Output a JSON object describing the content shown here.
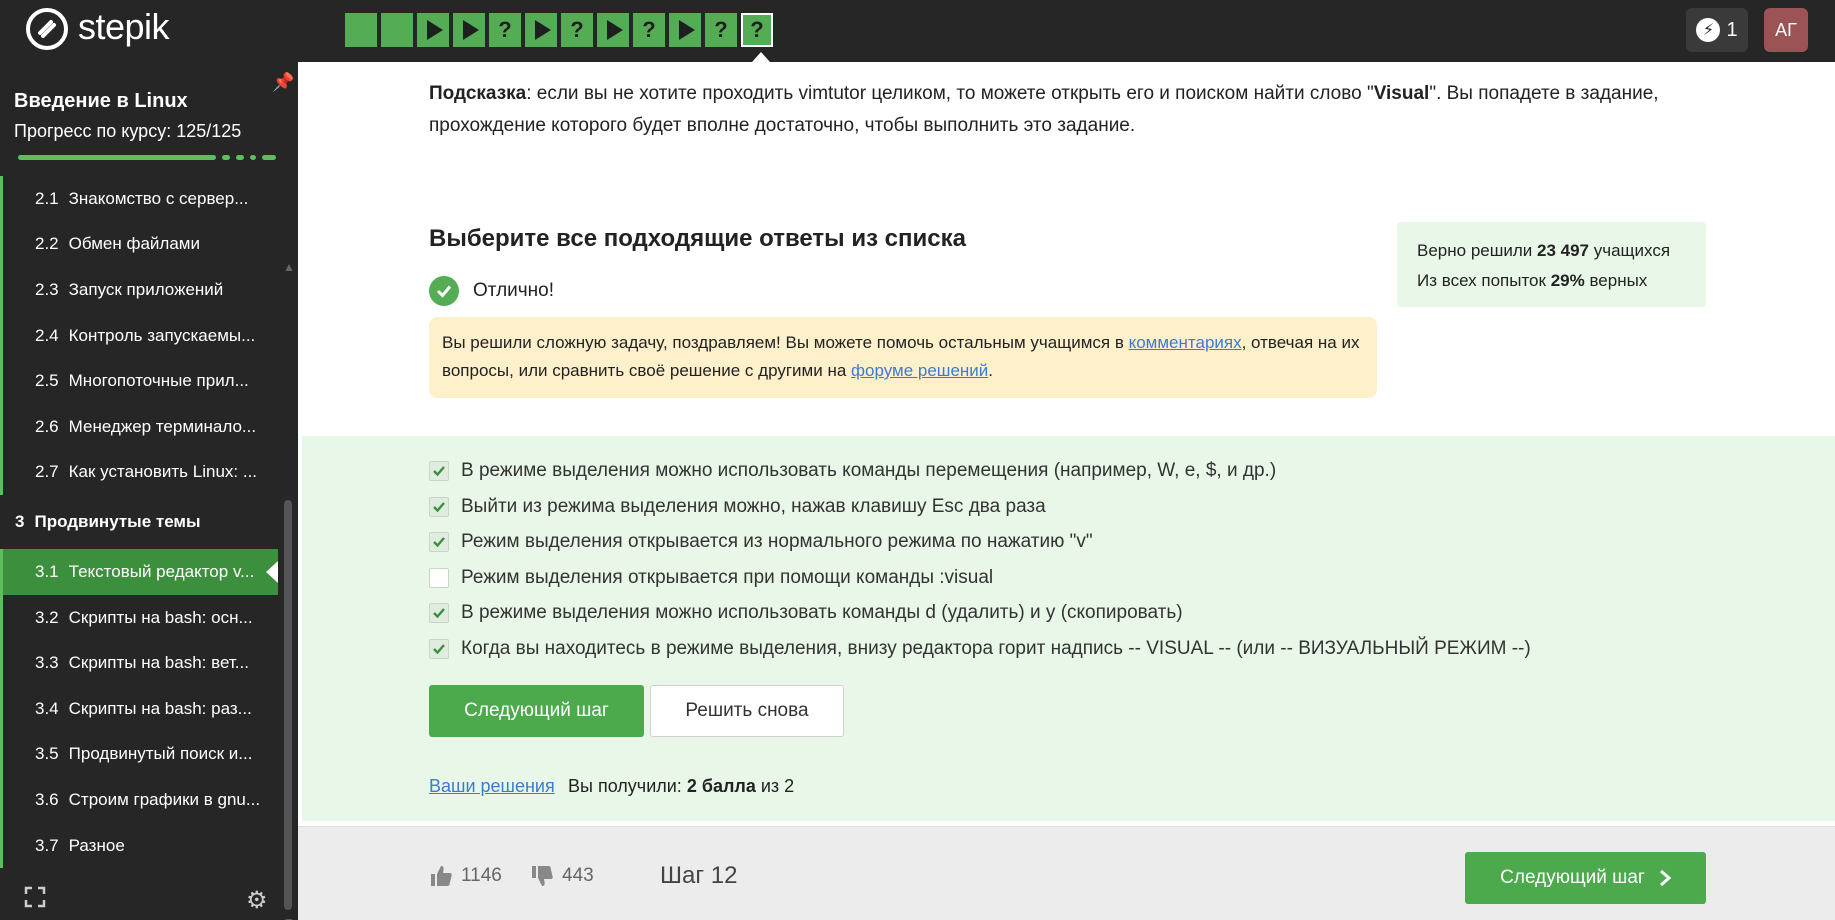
{
  "topbar": {
    "logo_text": "stepik",
    "steps": [
      {
        "type": "square"
      },
      {
        "type": "square"
      },
      {
        "type": "play"
      },
      {
        "type": "play"
      },
      {
        "type": "question",
        "label": "?"
      },
      {
        "type": "play"
      },
      {
        "type": "question",
        "label": "?"
      },
      {
        "type": "play"
      },
      {
        "type": "question",
        "label": "?"
      },
      {
        "type": "play"
      },
      {
        "type": "question",
        "label": "?"
      },
      {
        "type": "question",
        "label": "?",
        "current": true
      }
    ],
    "energy_count": "1",
    "avatar_initials": "АГ"
  },
  "sidebar": {
    "course_title": "Введение в Linux",
    "progress_label": "Прогресс по курсу:  125/125",
    "lessons": [
      {
        "num": "2.1",
        "title": "Знакомство с сервер..."
      },
      {
        "num": "2.2",
        "title": "Обмен файлами"
      },
      {
        "num": "2.3",
        "title": "Запуск приложений"
      },
      {
        "num": "2.4",
        "title": "Контроль запускаемы..."
      },
      {
        "num": "2.5",
        "title": "Многопоточные прил..."
      },
      {
        "num": "2.6",
        "title": "Менеджер терминало..."
      },
      {
        "num": "2.7",
        "title": "Как установить Linux: ..."
      },
      {
        "num": "3",
        "title": "Продвинутые темы",
        "section": true
      },
      {
        "num": "3.1",
        "title": "Текстовый редактор v...",
        "active": true
      },
      {
        "num": "3.2",
        "title": "Скрипты на bash: осн..."
      },
      {
        "num": "3.3",
        "title": "Скрипты на bash: вет..."
      },
      {
        "num": "3.4",
        "title": "Скрипты на bash: раз..."
      },
      {
        "num": "3.5",
        "title": "Продвинутый поиск и..."
      },
      {
        "num": "3.6",
        "title": "Строим графики в gnu..."
      },
      {
        "num": "3.7",
        "title": "Разное"
      }
    ]
  },
  "hint": {
    "label": "Подсказка",
    "text_1": ": если вы не хотите проходить vimtutor целиком, то можете открыть его и поиском найти слово \"",
    "keyword": "Visual",
    "text_2": "\". Вы попадете в задание, прохождение которого будет вполне достаточно, чтобы выполнить это задание."
  },
  "question": {
    "title": "Выберите все подходящие ответы из списка",
    "status": "Отлично!",
    "congrats_1": "Вы решили сложную задачу, поздравляем! Вы можете помочь остальным учащимся в ",
    "comments_link": "комментариях",
    "congrats_2": ", отвечая на их вопросы, или сравнить своё решение с другими на ",
    "forum_link": "форуме решений",
    "congrats_3": "."
  },
  "stats": {
    "solved_prefix": "Верно решили ",
    "solved_count": "23 497",
    "solved_suffix": " учащихся",
    "attempts_prefix": "Из всех попыток ",
    "attempts_percent": "29%",
    "attempts_suffix": " верных"
  },
  "options": [
    {
      "text": "В режиме выделения можно использовать команды перемещения (например, W, e, $, и др.)",
      "checked": true
    },
    {
      "text": "Выйти из режима выделения можно, нажав клавишу Esc два раза",
      "checked": true
    },
    {
      "text": "Режим выделения открывается из нормального режима по нажатию \"v\"",
      "checked": true
    },
    {
      "text": "Режим выделения открывается при помощи команды :visual",
      "checked": false
    },
    {
      "text": "В режиме выделения можно использовать команды d (удалить) и y (скопировать)",
      "checked": true
    },
    {
      "text": "Когда вы находитесь в режиме выделения, внизу редактора горит надпись -- VISUAL -- (или -- ВИЗУАЛЬНЫЙ РЕЖИМ --)",
      "checked": true
    }
  ],
  "actions": {
    "next_label": "Следующий шаг",
    "retry_label": "Решить снова",
    "your_solutions": "Ваши решения",
    "score_prefix": "Вы получили: ",
    "score_value": "2 балла",
    "score_suffix": " из 2"
  },
  "footer": {
    "likes": "1146",
    "dislikes": "443",
    "step_label": "Шаг 12",
    "next_label": "Следующий шаг"
  },
  "colors": {
    "accent_green": "#4caa4c",
    "topbar": "#262626",
    "answers_bg": "#e8f7e8",
    "congrats_bg": "#fff0cc",
    "link": "#3a7bd5"
  }
}
